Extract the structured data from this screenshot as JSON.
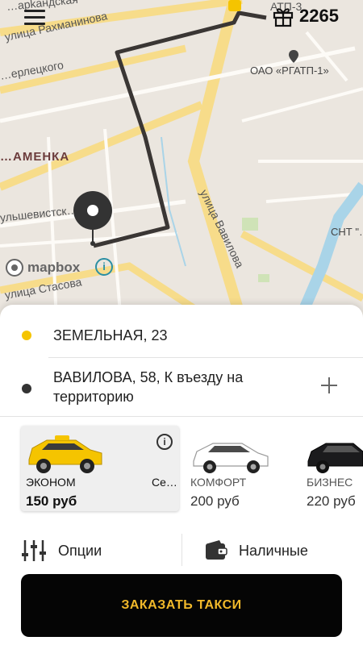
{
  "map": {
    "streets": [
      "…арkандская",
      "улица Рахманинова",
      "…ерлецкого",
      "ульшевистск…ица",
      "улица Стасова",
      "улица Вавилова",
      "АТП-3"
    ],
    "district": "…АМЕНКА",
    "poi_label": "ОАО «РГАТП-1»",
    "snt_label": "СНТ \"…",
    "attribution": "mapbox",
    "attribution_info": "i"
  },
  "header": {
    "bonus_value": "2265"
  },
  "route": {
    "from": "ЗЕМЕЛЬНАЯ, 23",
    "to": "ВАВИЛОВА, 58, К въезду на территорию",
    "from_color": "#f5c400",
    "to_color": "#333333"
  },
  "tariffs": [
    {
      "name": "ЭКОНОМ",
      "price": "150 руб",
      "extra": "Се…",
      "info": "i",
      "selected": true
    },
    {
      "name": "КОМФОРТ",
      "price": "200 руб",
      "selected": false
    },
    {
      "name": "БИЗНЕС",
      "price": "220 руб",
      "selected": false
    }
  ],
  "options": {
    "options_label": "Опции",
    "payment_label": "Наличные"
  },
  "order": {
    "label": "ЗАКАЗАТЬ ТАКСИ",
    "bg_color": "#050505",
    "text_color": "#f2b92a"
  }
}
